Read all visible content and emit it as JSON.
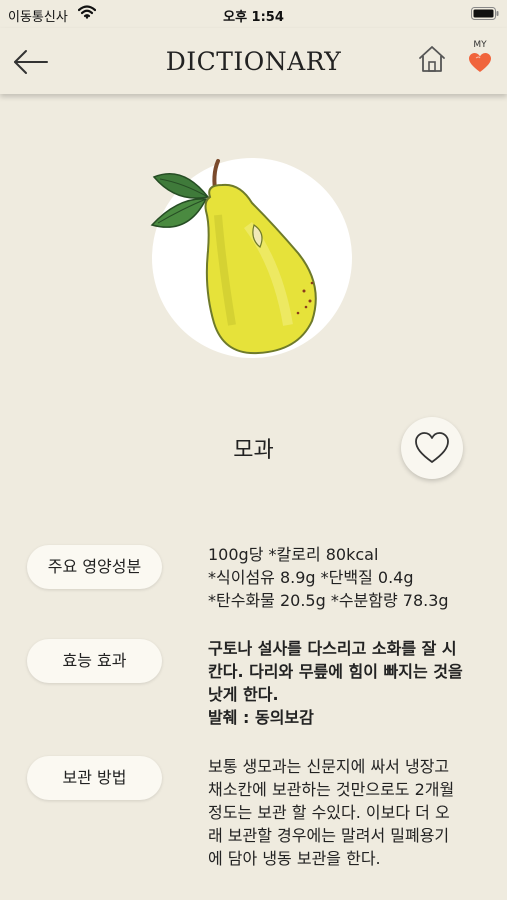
{
  "status_bar": {
    "carrier": "이동통신사",
    "time": "오후 1:54"
  },
  "nav": {
    "title": "DICTIONARY",
    "my_label": "MY",
    "heart_color": "#f0643c"
  },
  "fruit": {
    "name": "모과",
    "illustration": "quince-illustration"
  },
  "sections": [
    {
      "label": "주요 영양성분",
      "lines": [
        "100g당 *칼로리 80kcal",
        "*식이섬유 8.9g *단백질 0.4g",
        "*탄수화물 20.5g *수분함량 78.3g"
      ]
    },
    {
      "label": "효능 효과",
      "lines": [
        "구토나 설사를 다스리고 소화를 잘 시",
        "칸다. 다리와 무릎에 힘이 빠지는 것을",
        "낫게 한다.",
        "발췌 : 동의보감"
      ]
    },
    {
      "label": "보관 방법",
      "lines": [
        "보통 생모과는 신문지에 싸서 냉장고",
        "채소칸에 보관하는 것만으로도 2개월",
        "정도는 보관 할 수있다. 이보다 더 오",
        "래 보관할 경우에는 말려서 밀폐용기",
        "에 담아 냉동 보관을 한다."
      ]
    }
  ]
}
